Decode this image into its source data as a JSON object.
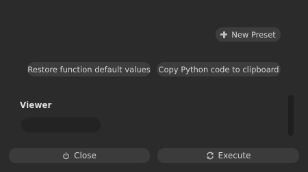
{
  "toolbar": {
    "new_preset_label": "New Preset",
    "restore_label": "Restore function default values",
    "copy_python_label": "Copy Python code to clipboard"
  },
  "viewer": {
    "label": "Viewer",
    "value": ""
  },
  "footer": {
    "close_label": "Close",
    "execute_label": "Execute"
  },
  "icons": {
    "new_preset": "plus-icon",
    "close": "power-icon",
    "execute": "refresh-icon"
  },
  "colors": {
    "background": "#2b2b2b",
    "button": "#3d3d3d",
    "field": "#232323",
    "text": "#d6d6d6"
  }
}
